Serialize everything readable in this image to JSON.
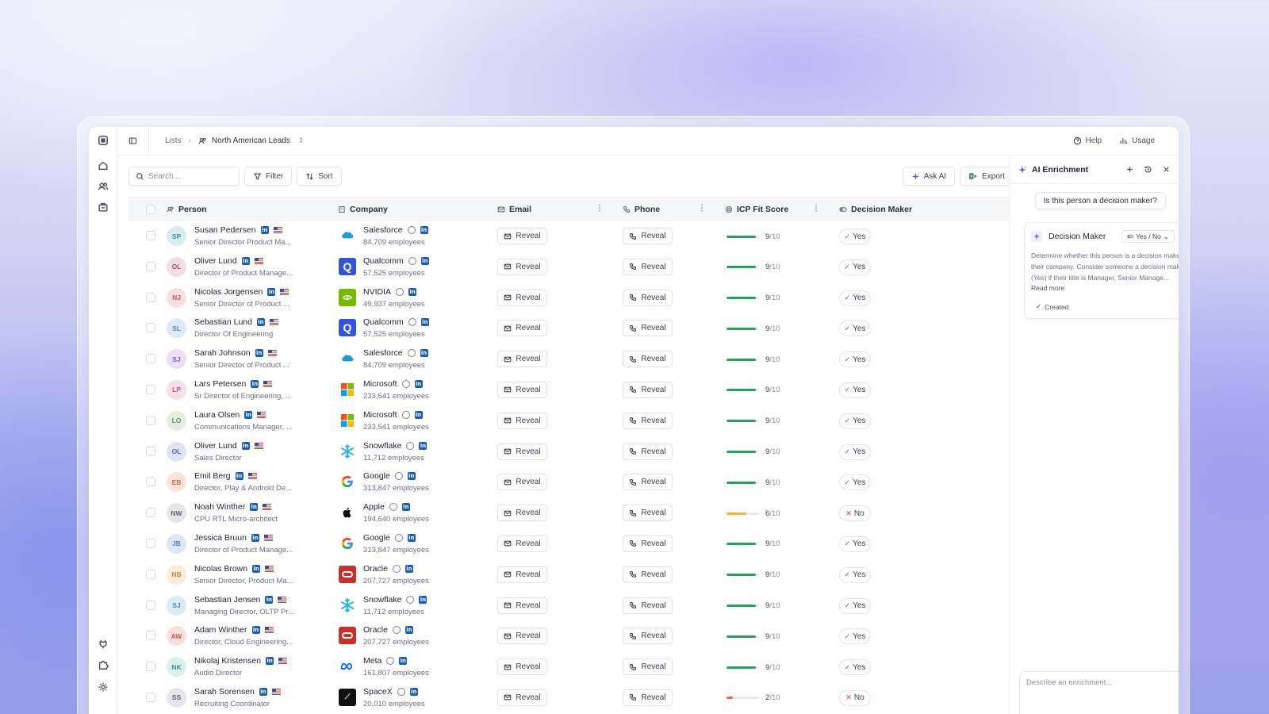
{
  "topbar": {
    "crumb": "Lists",
    "list_name": "North American Leads",
    "help": "Help",
    "usage": "Usage"
  },
  "toolbar": {
    "search_placeholder": "Search...",
    "filter": "Filter",
    "sort": "Sort",
    "ask_ai": "Ask AI",
    "export": "Export"
  },
  "columns": {
    "person": "Person",
    "company": "Company",
    "email": "Email",
    "phone": "Phone",
    "icp": "ICP Fit Score",
    "decision": "Decision Maker"
  },
  "reveal_label": "Reveal",
  "rows": [
    {
      "initials": "SP",
      "name": "Susan Pedersen",
      "title": "Senior Director Product Ma...",
      "company": "Salesforce",
      "employees": "84,709 employees",
      "logo": "salesforce",
      "score": 9,
      "score_max": 10,
      "decision": "Yes",
      "avatar_color": "#d9ecef",
      "avatar_text": "#3f8f99"
    },
    {
      "initials": "OL",
      "name": "Oliver Lund",
      "title": "Director of Product Manage...",
      "company": "Qualcomm",
      "employees": "57,525 employees",
      "logo": "qualcomm",
      "score": 9,
      "score_max": 10,
      "decision": "Yes",
      "avatar_color": "#f3dfe3",
      "avatar_text": "#a35868"
    },
    {
      "initials": "NJ",
      "name": "Nicolas Jorgensen",
      "title": "Senior Director of Product ...",
      "company": "NVIDIA",
      "employees": "49,937 employees",
      "logo": "nvidia",
      "score": 9,
      "score_max": 10,
      "decision": "Yes",
      "avatar_color": "#fbe0e0",
      "avatar_text": "#c9575a"
    },
    {
      "initials": "SL",
      "name": "Sebastian Lund",
      "title": "Director Of Engineering",
      "company": "Qualcomm",
      "employees": "57,525 employees",
      "logo": "qualcomm",
      "score": 9,
      "score_max": 10,
      "decision": "Yes",
      "avatar_color": "#dcebf5",
      "avatar_text": "#4d88b5"
    },
    {
      "initials": "SJ",
      "name": "Sarah Johnson",
      "title": "Senior Director of Product ...",
      "company": "Salesforce",
      "employees": "84,709 employees",
      "logo": "salesforce",
      "score": 9,
      "score_max": 10,
      "decision": "Yes",
      "avatar_color": "#eadff4",
      "avatar_text": "#8b5ab0"
    },
    {
      "initials": "LP",
      "name": "Lars Petersen",
      "title": "Sr Director of Engineering, ...",
      "company": "Microsoft",
      "employees": "233,541 employees",
      "logo": "microsoft",
      "score": 9,
      "score_max": 10,
      "decision": "Yes",
      "avatar_color": "#f6dfe9",
      "avatar_text": "#b35582"
    },
    {
      "initials": "LO",
      "name": "Laura Olsen",
      "title": "Communications Manager, ...",
      "company": "Microsoft",
      "employees": "233,541 employees",
      "logo": "microsoft",
      "score": 9,
      "score_max": 10,
      "decision": "Yes",
      "avatar_color": "#e2efdf",
      "avatar_text": "#5f9652"
    },
    {
      "initials": "OL",
      "name": "Oliver Lund",
      "title": "Sales Director",
      "company": "Snowflake",
      "employees": "11,712 employees",
      "logo": "snowflake",
      "score": 9,
      "score_max": 10,
      "decision": "Yes",
      "avatar_color": "#dfe4f5",
      "avatar_text": "#5566aa"
    },
    {
      "initials": "EB",
      "name": "Emil Berg",
      "title": "Director, Play & Android De...",
      "company": "Google",
      "employees": "313,847 employees",
      "logo": "google",
      "score": 9,
      "score_max": 10,
      "decision": "Yes",
      "avatar_color": "#fbe3da",
      "avatar_text": "#c86a46"
    },
    {
      "initials": "NW",
      "name": "Noah Winther",
      "title": "CPU RTL Micro-architect",
      "company": "Apple",
      "employees": "194,640 employees",
      "logo": "apple",
      "score": 6,
      "score_max": 10,
      "decision": "No",
      "avatar_color": "#e6e7ea",
      "avatar_text": "#5e6270"
    },
    {
      "initials": "JB",
      "name": "Jessica Bruun",
      "title": "Director of Product Manage...",
      "company": "Google",
      "employees": "313,847 employees",
      "logo": "google",
      "score": 9,
      "score_max": 10,
      "decision": "Yes",
      "avatar_color": "#dde8f7",
      "avatar_text": "#4f7fbf"
    },
    {
      "initials": "NB",
      "name": "Nicolas Brown",
      "title": "Senior Director, Product Ma...",
      "company": "Oracle",
      "employees": "207,727 employees",
      "logo": "oracle",
      "score": 9,
      "score_max": 10,
      "decision": "Yes",
      "avatar_color": "#fcebd8",
      "avatar_text": "#c98a3a"
    },
    {
      "initials": "SJ",
      "name": "Sebastian Jensen",
      "title": "Managing Director, OLTP Pr...",
      "company": "Snowflake",
      "employees": "11,712 employees",
      "logo": "snowflake",
      "score": 9,
      "score_max": 10,
      "decision": "Yes",
      "avatar_color": "#dcecf6",
      "avatar_text": "#4d8bb6"
    },
    {
      "initials": "AW",
      "name": "Adam Winther",
      "title": "Director, Cloud Engineering...",
      "company": "Oracle",
      "employees": "207,727 employees",
      "logo": "oracle",
      "score": 9,
      "score_max": 10,
      "decision": "Yes",
      "avatar_color": "#fbdfdc",
      "avatar_text": "#c55a4f"
    },
    {
      "initials": "NK",
      "name": "Nikolaj Kristensen",
      "title": "Audio Director",
      "company": "Meta",
      "employees": "161,807 employees",
      "logo": "meta",
      "score": 9,
      "score_max": 10,
      "decision": "Yes",
      "avatar_color": "#dcefec",
      "avatar_text": "#3f968a"
    },
    {
      "initials": "SS",
      "name": "Sarah Sorensen",
      "title": "Recruiting Coordinator",
      "company": "SpaceX",
      "employees": "20,010 employees",
      "logo": "spacex",
      "score": 2,
      "score_max": 10,
      "decision": "No",
      "avatar_color": "#e6e7ea",
      "avatar_text": "#5e6270"
    }
  ],
  "colors": {
    "score_high": "#22a559",
    "score_mid": "#f2b632",
    "score_low": "#ef6b4a",
    "decision_no": "#d9443c",
    "linkedin": "#1a5dc2"
  },
  "panel": {
    "title": "AI Enrichment",
    "question": "Is this person a decision maker?",
    "card_title": "Decision Maker",
    "card_type": "Yes / No",
    "card_desc": "Determine whether this person is a decision maker at their company. Consider someone a decision maker (Yes) if their title is Manager, Senior Manage...",
    "read_more": "Read more",
    "created": "Created",
    "composer_placeholder": "Describe an enrichment..."
  }
}
